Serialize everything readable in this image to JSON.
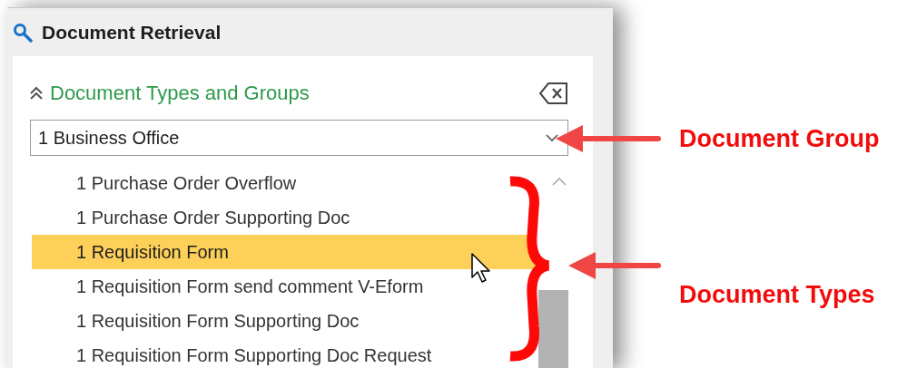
{
  "panel": {
    "title": "Document Retrieval",
    "section": {
      "title": "Document Types and Groups",
      "expanded": true
    },
    "group_dropdown": {
      "value": "1 Business Office"
    },
    "document_types": [
      {
        "label": "1 Purchase Order Overflow",
        "selected": false
      },
      {
        "label": "1 Purchase Order Supporting Doc",
        "selected": false
      },
      {
        "label": "1 Requisition Form",
        "selected": true
      },
      {
        "label": "1 Requisition Form send comment V-Eform",
        "selected": false
      },
      {
        "label": "1 Requisition Form Supporting Doc",
        "selected": false
      },
      {
        "label": "1 Requisition Form Supporting Doc Request",
        "selected": false
      }
    ]
  },
  "annotations": [
    {
      "label": "Document Group",
      "kind": "arrow"
    },
    {
      "label": "Document Types",
      "kind": "brace"
    }
  ]
}
